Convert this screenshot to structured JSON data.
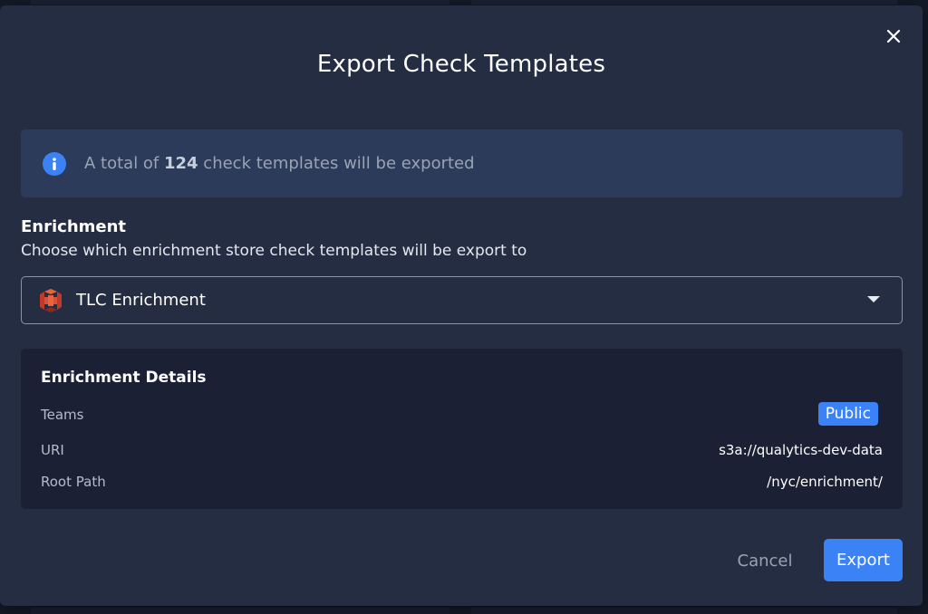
{
  "modal": {
    "title": "Export Check Templates",
    "close_icon": "close-icon"
  },
  "info": {
    "icon": "info-icon",
    "prefix": "A total of ",
    "count": "124",
    "suffix": " check templates will be exported"
  },
  "enrichment": {
    "label": "Enrichment",
    "description": "Choose which enrichment store check templates will be export to",
    "selected": "TLC Enrichment",
    "selected_icon": "enrichment-store-logo-icon"
  },
  "details": {
    "title": "Enrichment Details",
    "rows": [
      {
        "label": "Teams",
        "value": "Public"
      },
      {
        "label": "URI",
        "value": "s3a://qualytics-dev-data"
      },
      {
        "label": "Root Path",
        "value": "/nyc/enrichment/"
      }
    ]
  },
  "actions": {
    "cancel_label": "Cancel",
    "export_label": "Export"
  },
  "colors": {
    "accent": "#3b82f6",
    "modal_bg": "#252d42",
    "info_bg": "#2d3b5a",
    "details_bg": "#1b2034"
  }
}
